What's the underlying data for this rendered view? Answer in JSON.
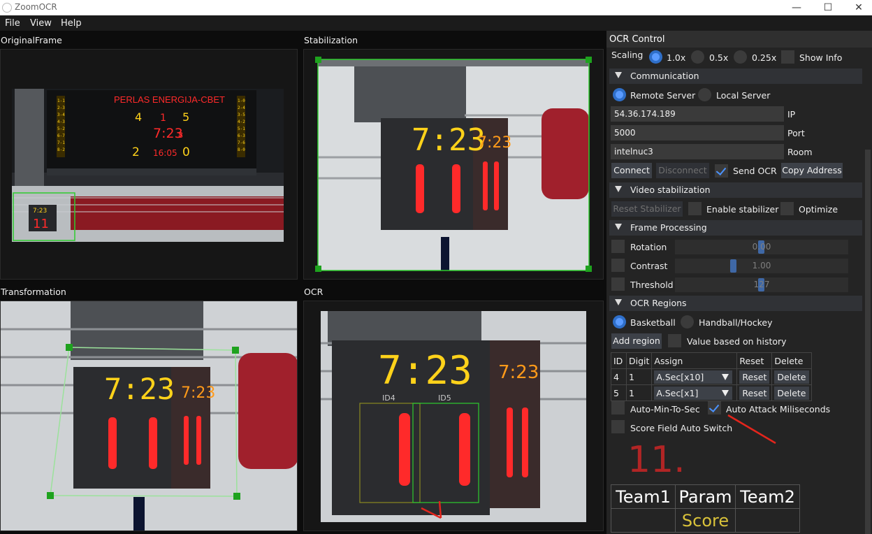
{
  "app": {
    "title": "ZoomOCR"
  },
  "window_controls": {
    "minimize": "—",
    "maximize": "☐",
    "close": "✕"
  },
  "menu": [
    "File",
    "View",
    "Help"
  ],
  "panels": {
    "original": "OriginalFrame",
    "stabilization": "Stabilization",
    "transformation": "Transformation",
    "ocr": "OCR"
  },
  "scoreboard": {
    "title": "PERLAS ENERGIJA-CBET",
    "home_fouls": "4",
    "period": "1",
    "guest_fouls": "5",
    "clock": "7:23",
    "clock_tenth": "8",
    "home_score": "2",
    "time": "16:05",
    "guest_score": "0",
    "shot_clock_top": "7:23",
    "shot_clock_bottom": "11",
    "side_digits": "7:23",
    "side_bottom": "11"
  },
  "ocr_view": {
    "region_4": "ID4",
    "region_5": "ID5"
  },
  "ocr_control": {
    "title": "OCR Control",
    "scaling_label": "Scaling",
    "scaling_options": [
      "1.0x",
      "0.5x",
      "0.25x"
    ],
    "scaling_selected": "1.0x",
    "show_info": "Show Info",
    "communication": {
      "header": "Communication",
      "remote": "Remote Server",
      "local": "Local Server",
      "ip_value": "54.36.174.189",
      "ip_label": "IP",
      "port_value": "5000",
      "port_label": "Port",
      "room_value": "intelnuc3",
      "room_label": "Room",
      "connect": "Connect",
      "disconnect": "Disconnect",
      "send_ocr": "Send OCR",
      "copy_address": "Copy Address"
    },
    "video": {
      "header": "Video stabilization",
      "reset": "Reset Stabilizer",
      "enable": "Enable stabilizer",
      "optimize": "Optimize"
    },
    "frame": {
      "header": "Frame Processing",
      "rotation_label": "Rotation",
      "rotation_value": "0.00",
      "contrast_label": "Contrast",
      "contrast_value": "1.00",
      "threshold_label": "Threshold",
      "threshold_value": "127"
    },
    "regions": {
      "header": "OCR Regions",
      "basketball": "Basketball",
      "handball": "Handball/Hockey",
      "add_region": "Add region",
      "value_history": "Value based on history",
      "columns": [
        "ID",
        "Digit",
        "Assign",
        "Reset",
        "Delete"
      ],
      "rows": [
        {
          "id": "4",
          "digit": "1",
          "assign": "A.Sec[x10]",
          "reset": "Reset",
          "delete": "Delete"
        },
        {
          "id": "5",
          "digit": "1",
          "assign": "A.Sec[x1]",
          "reset": "Reset",
          "delete": "Delete"
        }
      ],
      "auto_min": "Auto-Min-To-Sec",
      "auto_attack": "Auto Attack Miliseconds",
      "score_switch": "Score Field Auto Switch"
    },
    "ocr_value": "11.",
    "score_table": {
      "team1": "Team1",
      "param": "Param",
      "team2": "Team2",
      "score": "Score"
    }
  },
  "colors": {
    "accent": "#4b93ff",
    "led_red": "#ff2a2a",
    "led_yellow": "#ffd21a",
    "arrow": "#e3251c",
    "score_text": "#d9c23a"
  }
}
